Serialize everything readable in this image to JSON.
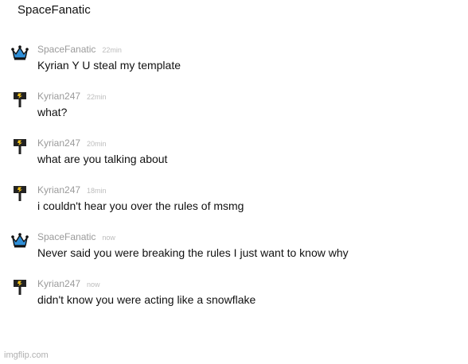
{
  "header": {
    "title": "SpaceFanatic"
  },
  "messages": [
    {
      "user": "SpaceFanatic",
      "time": "22min",
      "text": "Kyrian Y U steal my template",
      "icon": "crown-icon"
    },
    {
      "user": "Kyrian247",
      "time": "22min",
      "text": "what?",
      "icon": "hammer-icon"
    },
    {
      "user": "Kyrian247",
      "time": "20min",
      "text": "what are you talking about",
      "icon": "hammer-icon"
    },
    {
      "user": "Kyrian247",
      "time": "18min",
      "text": "i couldn't hear you over the rules of msmg",
      "icon": "hammer-icon"
    },
    {
      "user": "SpaceFanatic",
      "time": "now",
      "text": "Never said you were breaking the rules I just want to know why",
      "icon": "crown-icon"
    },
    {
      "user": "Kyrian247",
      "time": "now",
      "text": "didn't know you were acting like a snowflake",
      "icon": "hammer-icon"
    }
  ],
  "watermark": "imgflip.com",
  "colors": {
    "crown": "#2f8fd8",
    "hammer_bolt": "#f2c21a",
    "hammer_body": "#222222"
  }
}
